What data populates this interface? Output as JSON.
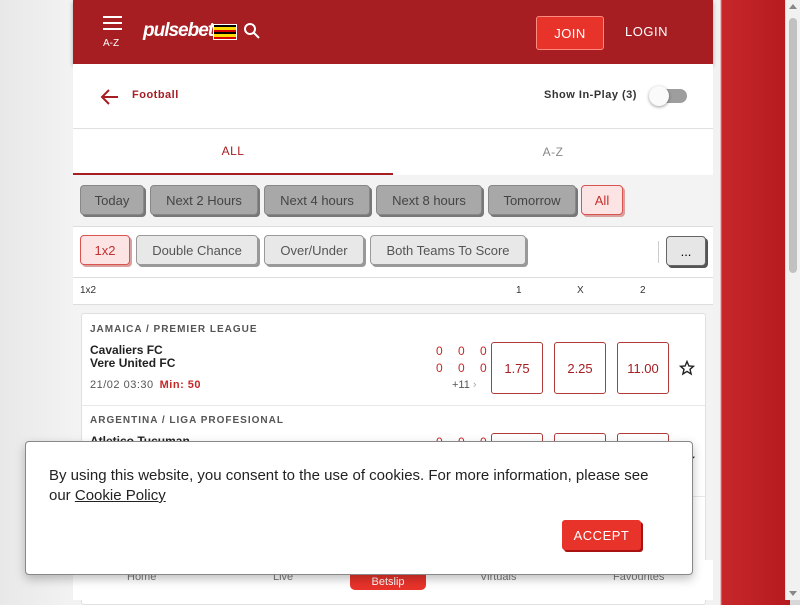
{
  "header": {
    "menu_label": "A-Z",
    "logo_text": "pulsebet",
    "join_label": "JOIN",
    "login_label": "LOGIN",
    "flag_colors": [
      "#000000",
      "#fcdc04",
      "#d90000",
      "#000000",
      "#fcdc04",
      "#d90000"
    ]
  },
  "subheader": {
    "title": "Football",
    "inplay_label": "Show In-Play (3)"
  },
  "tabs": [
    {
      "label": "ALL"
    },
    {
      "label": "A-Z"
    }
  ],
  "time_filters": [
    "Today",
    "Next 2 Hours",
    "Next 4 hours",
    "Next 8 hours",
    "Tomorrow",
    "All"
  ],
  "market_filters": [
    "1x2",
    "Double Chance",
    "Over/Under",
    "Both Teams To Score"
  ],
  "more_label": "...",
  "columns": {
    "market": "1x2",
    "c1": "1",
    "cx": "X",
    "c2": "2"
  },
  "events": [
    {
      "league": "JAMAICA / PREMIER LEAGUE",
      "home": "Cavaliers FC",
      "away": "Vere United FC",
      "datetime": "21/02 03:30",
      "minute": "Min: 50",
      "home_score": "0 0 0",
      "away_score": "0 0 0",
      "more": "+11",
      "odds": [
        "1.75",
        "2.25",
        "11.00"
      ]
    },
    {
      "league": "ARGENTINA / LIGA PROFESIONAL",
      "home": "Atletico Tucuman",
      "home_score": "0 0 0"
    }
  ],
  "bottom_nav": {
    "home": "Home",
    "live": "Live",
    "betslip": "Betslip",
    "virtuals": "Virtuals",
    "favourites": "Favourites"
  },
  "cookie": {
    "text": "By using this website, you consent to the use of cookies. For more information, please see our",
    "link": "Cookie Policy",
    "accept": "ACCEPT"
  },
  "colors": {
    "brand": "#a61d22",
    "accent": "#e8332b"
  }
}
